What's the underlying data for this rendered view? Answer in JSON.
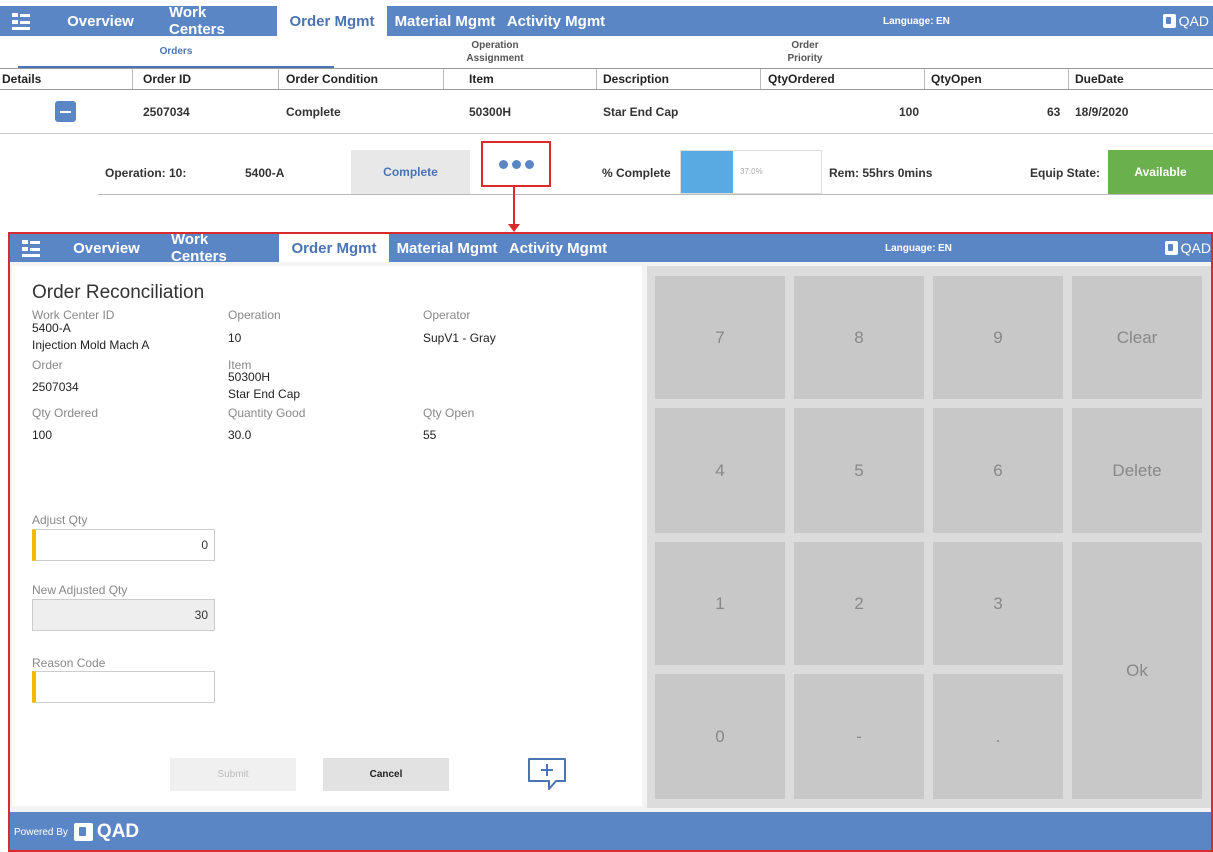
{
  "top_nav": {
    "tabs": [
      "Overview",
      "Work Centers",
      "Order Mgmt",
      "Material Mgmt",
      "Activity Mgmt"
    ],
    "language_label": "Language:",
    "language_value": "EN",
    "brand": "QAD"
  },
  "sub_tabs": [
    "Orders",
    "Operation\nAssignment",
    "Order\nPriority"
  ],
  "orders_table": {
    "columns": [
      "Details",
      "Order ID",
      "Order Condition",
      "Item",
      "Description",
      "QtyOrdered",
      "QtyOpen",
      "DueDate"
    ],
    "row": {
      "order_id": "2507034",
      "order_condition": "Complete",
      "item": "50300H",
      "description": "Star End Cap",
      "qty_ordered": "100",
      "qty_open": "63",
      "due_date": "18/9/2020"
    }
  },
  "operation_row": {
    "operation_label": "Operation: 10:",
    "work_center": "5400-A",
    "status": "Complete",
    "pct_label": "% Complete",
    "pct_value": "37.0%",
    "pct_fraction": 0.37,
    "remaining": "Rem: 55hrs 0mins",
    "equip_label": "Equip State:",
    "equip_value": "Available"
  },
  "detail_nav": {
    "tabs": [
      "Overview",
      "Work Centers",
      "Order Mgmt",
      "Material Mgmt",
      "Activity Mgmt"
    ],
    "language_label": "Language:",
    "language_value": "EN",
    "brand": "QAD"
  },
  "reconciliation": {
    "title": "Order Reconciliation",
    "work_center_label": "Work Center ID",
    "work_center_id": "5400-A",
    "work_center_name": "Injection Mold Mach A",
    "operation_label": "Operation",
    "operation_value": "10",
    "operator_label": "Operator",
    "operator_value": "SupV1 - Gray",
    "order_label": "Order",
    "order_value": "2507034",
    "item_label": "Item",
    "item_value": "50300H",
    "item_desc": "Star End Cap",
    "qty_ordered_label": "Qty Ordered",
    "qty_ordered_value": "100",
    "qty_good_label": "Quantity Good",
    "qty_good_value": "30.0",
    "qty_open_label": "Qty Open",
    "qty_open_value": "55",
    "adjust_qty_label": "Adjust Qty",
    "adjust_qty_value": "0",
    "new_adjusted_label": "New Adjusted Qty",
    "new_adjusted_value": "30",
    "reason_code_label": "Reason Code",
    "reason_code_value": "",
    "submit_label": "Submit",
    "cancel_label": "Cancel"
  },
  "keypad": {
    "k7": "7",
    "k8": "8",
    "k9": "9",
    "clear": "Clear",
    "k4": "4",
    "k5": "5",
    "k6": "6",
    "delete": "Delete",
    "k1": "1",
    "k2": "2",
    "k3": "3",
    "ok": "Ok",
    "k0": "0",
    "minus": "-",
    "dot": "."
  },
  "footer": {
    "powered_by": "Powered By",
    "brand": "QAD"
  },
  "colors": {
    "nav_blue": "#5b86c6",
    "highlight_red": "#d92b2b",
    "available_green": "#6ab04c",
    "progress_blue": "#59a9e2",
    "required_yellow": "#f5b800"
  }
}
